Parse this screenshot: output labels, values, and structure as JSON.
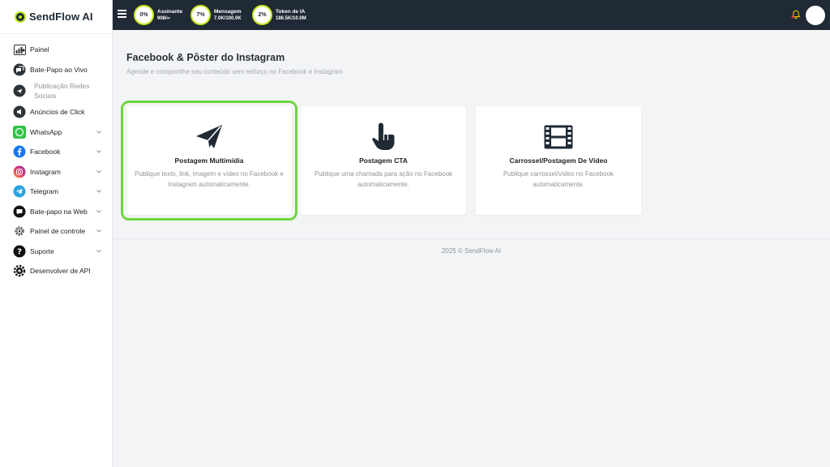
{
  "brand": {
    "name": "SendFlow AI"
  },
  "sidebar": {
    "items": [
      {
        "label": "Painel",
        "icon": "chart-icon",
        "has_chevron": false
      },
      {
        "label": "Bate-Papo ao Vivo",
        "icon": "live-chat-icon",
        "has_chevron": false
      },
      {
        "label": "Publicação Redes Sociais",
        "icon": "social-post-icon",
        "has_chevron": false
      },
      {
        "label": "Anúncios de Click",
        "icon": "ads-icon",
        "has_chevron": false
      },
      {
        "label": "WhatsApp",
        "icon": "whatsapp-icon",
        "has_chevron": true
      },
      {
        "label": "Facebook",
        "icon": "facebook-icon",
        "has_chevron": true
      },
      {
        "label": "Instagram",
        "icon": "instagram-icon",
        "has_chevron": true
      },
      {
        "label": "Telegram",
        "icon": "telegram-icon",
        "has_chevron": true
      },
      {
        "label": "Bate-papo na Web",
        "icon": "web-chat-icon",
        "has_chevron": true
      },
      {
        "label": "Painel de controle",
        "icon": "settings-icon",
        "has_chevron": true
      },
      {
        "label": "Suporte",
        "icon": "help-icon",
        "has_chevron": true
      },
      {
        "label": "Desenvolver de API",
        "icon": "api-gear-icon",
        "has_chevron": false
      }
    ]
  },
  "topbar": {
    "stats": [
      {
        "percent": "0%",
        "label": "Assinante",
        "value": "908/∞"
      },
      {
        "percent": "7%",
        "label": "Mensagem",
        "value": "7.0K/100.0K"
      },
      {
        "percent": "2%",
        "label": "Token de IA",
        "value": "186.5K/10.0M"
      }
    ]
  },
  "page": {
    "title": "Facebook & Pôster do Instagram",
    "subtitle": "Agende e compartilhe seu conteúdo sem esforço no Facebook e Instagram"
  },
  "cards": [
    {
      "title": "Postagem Multimídia",
      "desc": "Publique texto, link, imagem e vídeo no Facebook e Instagram automaticamente.",
      "icon": "paper-plane-icon",
      "selected": true
    },
    {
      "title": "Postagem CTA",
      "desc": "Publique uma chamada para ação no Facebook automaticamente.",
      "icon": "pointing-hand-icon",
      "selected": false
    },
    {
      "title": "Carrossel/Postagem De Vídeo",
      "desc": "Publique carrossel/vídeo no Facebook automaticamente.",
      "icon": "film-icon",
      "selected": false
    }
  ],
  "footer": {
    "text": "2025 © SendFlow AI"
  },
  "colors": {
    "topbar": "#1f2a35",
    "accent_ring": "#c5e81c",
    "selected_outline": "#6fd53f",
    "background": "#f3f4f6"
  }
}
